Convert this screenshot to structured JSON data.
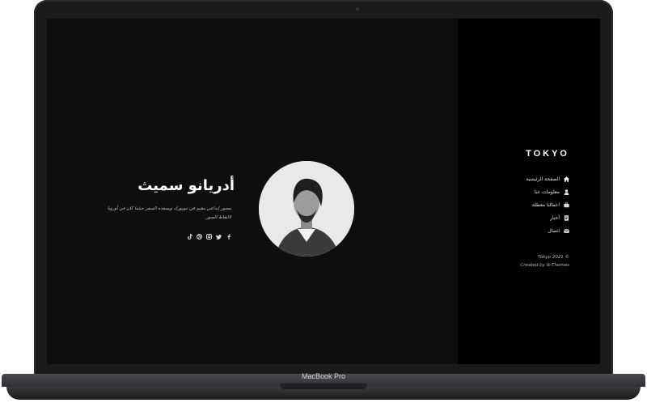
{
  "device": {
    "model_label": "MacBook Pro"
  },
  "sidebar": {
    "logo": "TOKYO",
    "items": [
      {
        "label": "الصفحة الرئيسية",
        "icon": "home-icon"
      },
      {
        "label": "معلومات عنا",
        "icon": "user-icon"
      },
      {
        "label": "اعمالنا معطلة",
        "icon": "briefcase-icon"
      },
      {
        "label": "أخبار",
        "icon": "news-icon"
      },
      {
        "label": "اتصال",
        "icon": "mail-icon"
      }
    ],
    "copyright_line1": "Tokyo 2021 ©",
    "copyright_line2": "Created by ib-Themes"
  },
  "hero": {
    "name": "أدريانو سميث",
    "bio": "مصور إبداعي مقيم في نيويورك ويسعده السفر حيثما كان في أوروبا لالتقاط الصور.",
    "socials": [
      "facebook-icon",
      "twitter-icon",
      "instagram-icon",
      "dribbble-icon",
      "tiktok-icon"
    ]
  }
}
